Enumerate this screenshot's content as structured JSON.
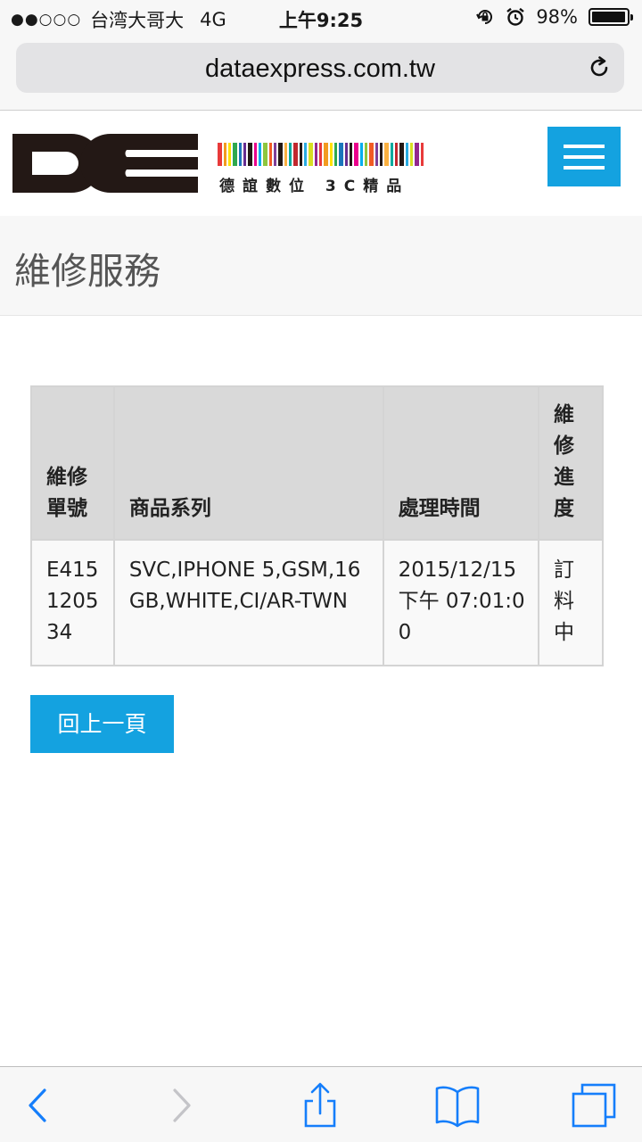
{
  "status_bar": {
    "signal": "●●○○○",
    "carrier": "台湾大哥大",
    "network": "4G",
    "time": "上午9:25",
    "battery_percent": "98%",
    "battery_level": 0.98,
    "icons": [
      "orientation-lock-icon",
      "alarm-icon",
      "battery-icon"
    ]
  },
  "browser": {
    "url": "dataexpress.com.tw",
    "reload_icon": "reload-icon"
  },
  "site": {
    "logo_text": "DE",
    "logo_tagline": "德誼數位 3C精品",
    "menu_icon": "hamburger-menu-icon",
    "accent_color": "#14a2e0"
  },
  "page": {
    "title": "維修服務"
  },
  "table": {
    "headers": [
      "維修單號",
      "商品系列",
      "處理時間",
      "維修進度"
    ],
    "rows": [
      {
        "order_no": "E415120534",
        "product": "SVC,IPHONE 5,GSM,16GB,WHITE,CI/AR-TWN",
        "time": "2015/12/15 下午 07:01:00",
        "status": "訂料中"
      }
    ]
  },
  "back_button": {
    "label": "回上一頁"
  },
  "toolbar": {
    "icons": [
      "back-icon",
      "forward-icon",
      "share-icon",
      "bookmarks-icon",
      "tabs-icon"
    ],
    "accent_color": "#157efb"
  }
}
